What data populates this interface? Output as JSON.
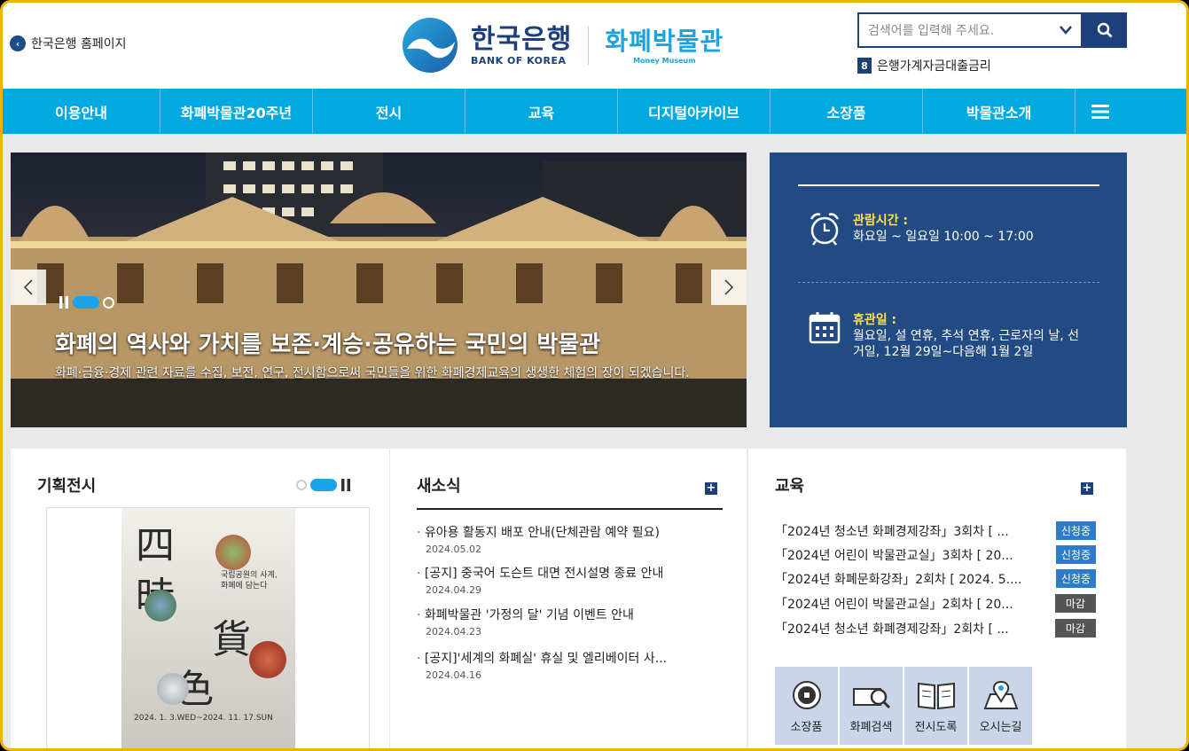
{
  "header": {
    "home_link": "한국은행 홈페이지",
    "logo_ko": "한국은행",
    "logo_en": "BANK OF KOREA",
    "museum_ko": "화폐박물관",
    "museum_en": "Money Museum",
    "search_placeholder": "검색어를 입력해 주세요.",
    "rate_number": "8",
    "rate_text": "은행가계자금대출금리"
  },
  "nav": {
    "items": [
      "이용안내",
      "화폐박물관20주년",
      "전시",
      "교육",
      "디지털아카이브",
      "소장품",
      "박물관소개"
    ]
  },
  "hero": {
    "title": "화폐의 역사와 가치를 보존·계승·공유하는 국민의 박물관",
    "description": "화폐·금융·경제 관련 자료를 수집, 보전, 연구, 전시함으로써 국민들을 위한 화폐경제교육의 생생한 체험의 장이 되겠습니다."
  },
  "info": {
    "hours_label": "관람시간 :",
    "hours_text": "화요일 ~ 일요일 10:00 ~ 17:00",
    "closed_label": "휴관일 :",
    "closed_text": "월요일, 설 연휴, 추석 연휴, 근로자의 날, 선거일, 12월 29일~다음해 1월 2일"
  },
  "exhibit": {
    "title": "기획전시",
    "poster_big1": "四",
    "poster_big2": "時",
    "poster_big3": "貨",
    "poster_big4": "色",
    "poster_sub": "국립공원의 사계, 화폐에 담는다",
    "poster_date": "2024. 1. 3.WED~2024. 11. 17.SUN"
  },
  "news": {
    "title": "새소식",
    "items": [
      {
        "text": "유아용 활동지 배포 안내(단체관람 예약 필요)",
        "date": "2024.05.02"
      },
      {
        "text": "[공지] 중국어 도슨트 대면 전시설명 종료 안내",
        "date": "2024.04.29"
      },
      {
        "text": "화폐박물관 '가정의 달' 기념 이벤트 안내",
        "date": "2024.04.23"
      },
      {
        "text": "[공지]'세계의 화폐실' 휴실 및 엘리베이터 사...",
        "date": "2024.04.16"
      }
    ]
  },
  "education": {
    "title": "교육",
    "items": [
      {
        "text": "「2024년 청소년 화폐경제강좌」3회차 [ ...",
        "status": "신청중",
        "color": "#2e7bc8"
      },
      {
        "text": "「2024년 어린이 박물관교실」3회차 [ 20...",
        "status": "신청중",
        "color": "#2e7bc8"
      },
      {
        "text": "「2024년 화폐문화강좌」2회차 [ 2024. 5....",
        "status": "신청중",
        "color": "#2e7bc8"
      },
      {
        "text": "「2024년 어린이 박물관교실」2회차 [ 20...",
        "status": "마감",
        "color": "#555555"
      },
      {
        "text": "「2024년 청소년 화폐경제강좌」2회차 [ ...",
        "status": "마감",
        "color": "#555555"
      }
    ]
  },
  "quick": {
    "items": [
      "소장품",
      "화폐검색",
      "전시도록",
      "오시는길"
    ]
  },
  "colors": {
    "navy": "#1d3f7a",
    "sky": "#00a9e0",
    "info_bg": "#234b83"
  }
}
